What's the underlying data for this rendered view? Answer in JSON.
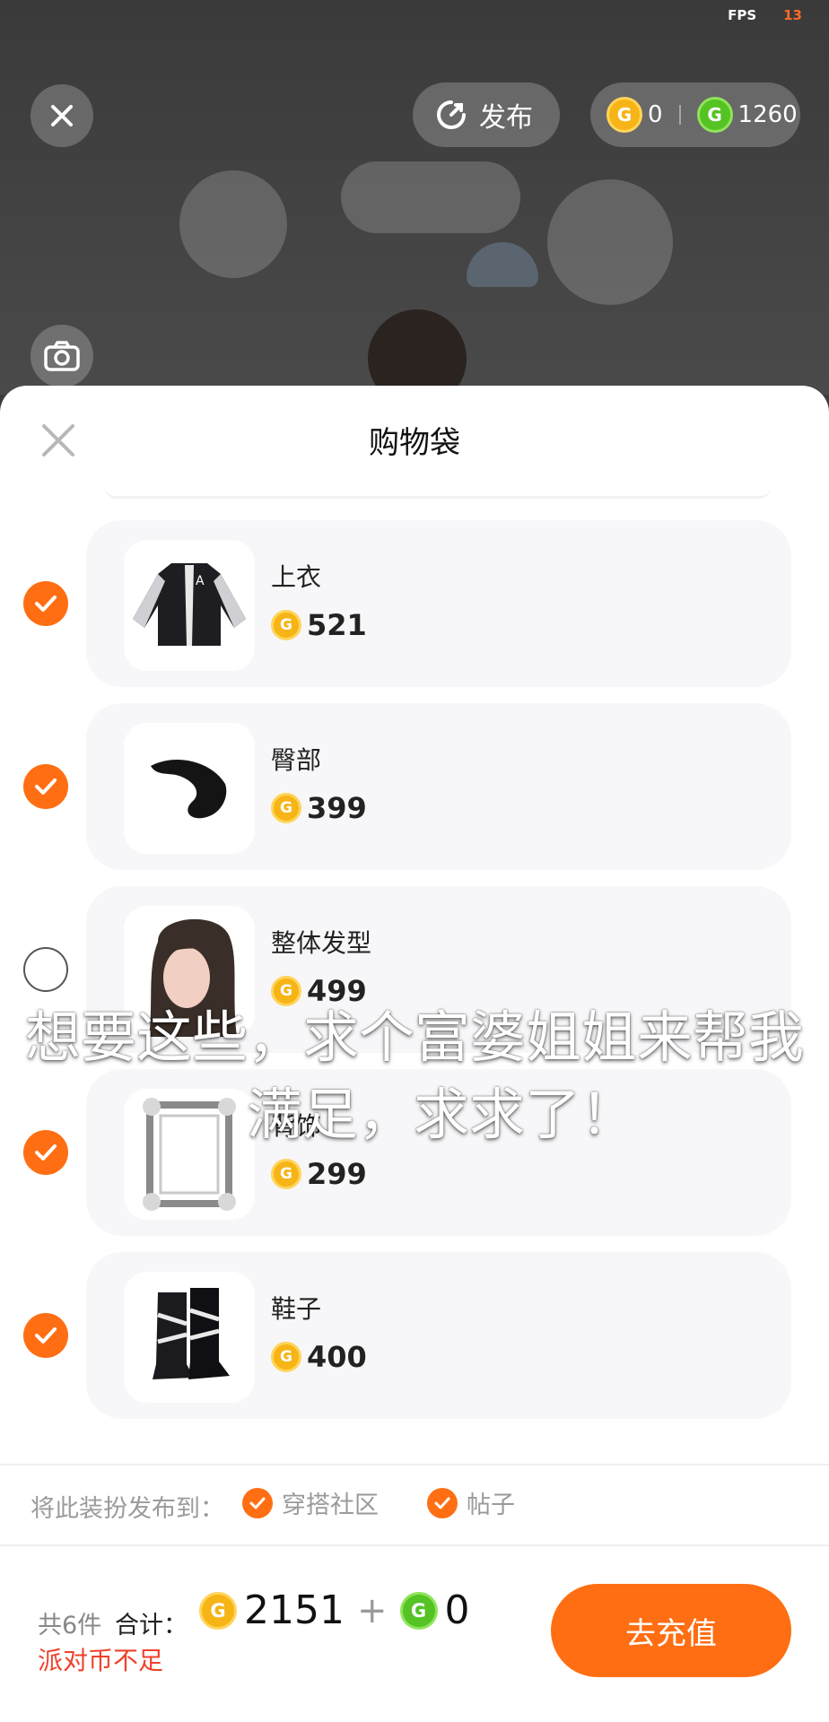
{
  "status": {
    "fps_label": "FPS",
    "fps_value": "13"
  },
  "topbar": {
    "publish_label": "发布",
    "gold_balance": "0",
    "green_balance": "1260"
  },
  "sheet": {
    "title": "购物袋"
  },
  "items": [
    {
      "name": "上衣",
      "price": "521",
      "checked": true,
      "thumb_icon": "jacket-thumbnail"
    },
    {
      "name": "臀部",
      "price": "399",
      "checked": true,
      "thumb_icon": "tail-thumbnail"
    },
    {
      "name": "整体发型",
      "price": "499",
      "checked": false,
      "thumb_icon": "hairstyle-thumbnail"
    },
    {
      "name": "背饰",
      "price": "299",
      "checked": true,
      "thumb_icon": "frame-thumbnail"
    },
    {
      "name": "鞋子",
      "price": "400",
      "checked": true,
      "thumb_icon": "boots-thumbnail"
    }
  ],
  "publish": {
    "label": "将此装扮发布到：",
    "option_community": "穿搭社区",
    "option_post": "帖子"
  },
  "footer": {
    "count": "共6件",
    "total_label": "合计：",
    "gold_total": "2151",
    "plus": "+",
    "green_total": "0",
    "warning": "派对币不足",
    "recharge_label": "去充值"
  },
  "caption": {
    "line1": "想要这些，求个富婆姐姐来帮我",
    "line2": "满足，求求了！"
  },
  "colors": {
    "accent": "#ff6e12",
    "warning": "#f0412b",
    "gold": "#f6b416",
    "green": "#54c323"
  }
}
